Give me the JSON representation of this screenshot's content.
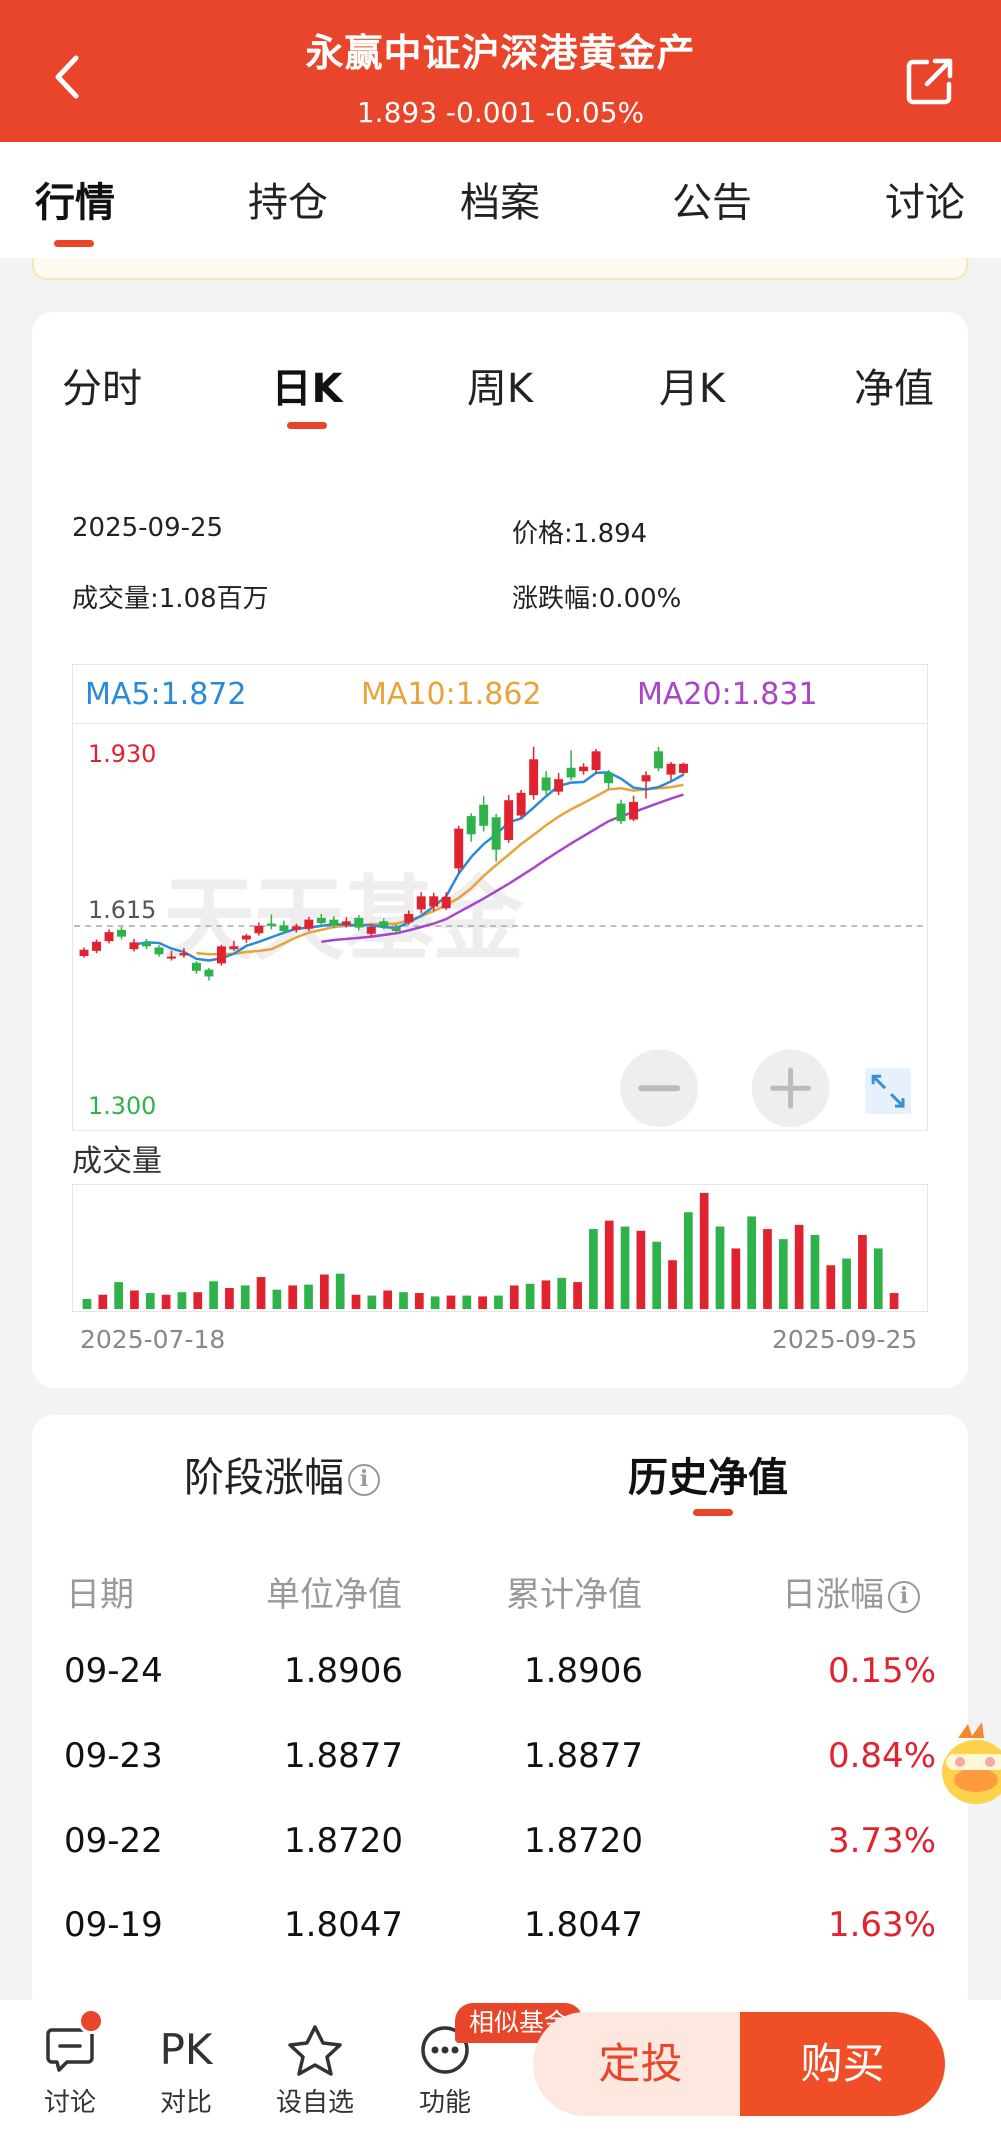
{
  "header": {
    "title": "永赢中证沪深港黄金产",
    "subtitle": "1.893 -0.001 -0.05%"
  },
  "main_tabs": [
    {
      "label": "行情",
      "active": true
    },
    {
      "label": "持仓"
    },
    {
      "label": "档案"
    },
    {
      "label": "公告"
    },
    {
      "label": "讨论"
    }
  ],
  "chart_tabs": [
    {
      "label": "分时"
    },
    {
      "label": "日K",
      "active": true
    },
    {
      "label": "周K"
    },
    {
      "label": "月K"
    },
    {
      "label": "净值"
    }
  ],
  "info": {
    "date": "2025-09-25",
    "price": "价格:1.894",
    "volume": "成交量:1.08百万",
    "change": "涨跌幅:0.00%"
  },
  "ma_legend": {
    "ma5": "MA5:1.872",
    "ma10": "MA10:1.862",
    "ma20": "MA20:1.831"
  },
  "colors": {
    "brand": "#e8452a",
    "up": "#e0232e",
    "down": "#2db34a",
    "ma5": "#2a8ad8",
    "ma10": "#e8a43a",
    "ma20": "#a845c8"
  },
  "chart_data": {
    "type": "candlestick",
    "y_ticks": [
      "1.930",
      "1.615",
      "1.300"
    ],
    "ylim": [
      1.3,
      1.93
    ],
    "watermark": "天天基金",
    "volume_label": "成交量",
    "x_start": "2025-07-18",
    "x_end": "2025-09-25",
    "candles": [
      {
        "o": 1.571,
        "c": 1.582,
        "h": 1.586,
        "l": 1.568
      },
      {
        "o": 1.58,
        "c": 1.596,
        "h": 1.6,
        "l": 1.576
      },
      {
        "o": 1.597,
        "c": 1.613,
        "h": 1.618,
        "l": 1.593
      },
      {
        "o": 1.617,
        "c": 1.605,
        "h": 1.622,
        "l": 1.6
      },
      {
        "o": 1.583,
        "c": 1.595,
        "h": 1.601,
        "l": 1.579
      },
      {
        "o": 1.595,
        "c": 1.588,
        "h": 1.601,
        "l": 1.583
      },
      {
        "o": 1.586,
        "c": 1.574,
        "h": 1.59,
        "l": 1.57
      },
      {
        "o": 1.567,
        "c": 1.57,
        "h": 1.58,
        "l": 1.563
      },
      {
        "o": 1.572,
        "c": 1.576,
        "h": 1.585,
        "l": 1.568
      },
      {
        "o": 1.559,
        "c": 1.545,
        "h": 1.562,
        "l": 1.54
      },
      {
        "o": 1.547,
        "c": 1.535,
        "h": 1.55,
        "l": 1.528
      },
      {
        "o": 1.558,
        "c": 1.588,
        "h": 1.591,
        "l": 1.554
      },
      {
        "o": 1.583,
        "c": 1.588,
        "h": 1.598,
        "l": 1.58
      },
      {
        "o": 1.6,
        "c": 1.607,
        "h": 1.61,
        "l": 1.594
      },
      {
        "o": 1.611,
        "c": 1.624,
        "h": 1.63,
        "l": 1.607
      },
      {
        "o": 1.628,
        "c": 1.624,
        "h": 1.644,
        "l": 1.618
      },
      {
        "o": 1.625,
        "c": 1.615,
        "h": 1.633,
        "l": 1.61
      },
      {
        "o": 1.617,
        "c": 1.623,
        "h": 1.628,
        "l": 1.612
      },
      {
        "o": 1.619,
        "c": 1.635,
        "h": 1.64,
        "l": 1.615
      },
      {
        "o": 1.638,
        "c": 1.629,
        "h": 1.645,
        "l": 1.625
      },
      {
        "o": 1.635,
        "c": 1.626,
        "h": 1.641,
        "l": 1.62
      },
      {
        "o": 1.626,
        "c": 1.632,
        "h": 1.639,
        "l": 1.621
      },
      {
        "o": 1.638,
        "c": 1.621,
        "h": 1.643,
        "l": 1.616
      },
      {
        "o": 1.61,
        "c": 1.622,
        "h": 1.626,
        "l": 1.605
      },
      {
        "o": 1.632,
        "c": 1.623,
        "h": 1.637,
        "l": 1.618
      },
      {
        "o": 1.621,
        "c": 1.615,
        "h": 1.627,
        "l": 1.613
      },
      {
        "o": 1.63,
        "c": 1.645,
        "h": 1.651,
        "l": 1.626
      },
      {
        "o": 1.653,
        "c": 1.676,
        "h": 1.683,
        "l": 1.646
      },
      {
        "o": 1.658,
        "c": 1.676,
        "h": 1.682,
        "l": 1.65
      },
      {
        "o": 1.655,
        "c": 1.675,
        "h": 1.683,
        "l": 1.652
      },
      {
        "o": 1.725,
        "c": 1.795,
        "h": 1.8,
        "l": 1.717
      },
      {
        "o": 1.817,
        "c": 1.785,
        "h": 1.822,
        "l": 1.772
      },
      {
        "o": 1.837,
        "c": 1.8,
        "h": 1.852,
        "l": 1.79
      },
      {
        "o": 1.815,
        "c": 1.758,
        "h": 1.821,
        "l": 1.737
      },
      {
        "o": 1.775,
        "c": 1.845,
        "h": 1.854,
        "l": 1.77
      },
      {
        "o": 1.818,
        "c": 1.858,
        "h": 1.863,
        "l": 1.813
      },
      {
        "o": 1.854,
        "c": 1.917,
        "h": 1.939,
        "l": 1.846
      },
      {
        "o": 1.885,
        "c": 1.862,
        "h": 1.896,
        "l": 1.855
      },
      {
        "o": 1.86,
        "c": 1.882,
        "h": 1.893,
        "l": 1.854
      },
      {
        "o": 1.902,
        "c": 1.885,
        "h": 1.933,
        "l": 1.88
      },
      {
        "o": 1.896,
        "c": 1.904,
        "h": 1.91,
        "l": 1.89
      },
      {
        "o": 1.898,
        "c": 1.931,
        "h": 1.935,
        "l": 1.892
      },
      {
        "o": 1.893,
        "c": 1.875,
        "h": 1.898,
        "l": 1.865
      },
      {
        "o": 1.839,
        "c": 1.808,
        "h": 1.846,
        "l": 1.803
      },
      {
        "o": 1.811,
        "c": 1.842,
        "h": 1.853,
        "l": 1.808
      },
      {
        "o": 1.878,
        "c": 1.889,
        "h": 1.896,
        "l": 1.848
      },
      {
        "o": 1.931,
        "c": 1.901,
        "h": 1.939,
        "l": 1.896
      },
      {
        "o": 1.89,
        "c": 1.909,
        "h": 1.912,
        "l": 1.88
      },
      {
        "o": 1.893,
        "c": 1.909,
        "h": 1.911,
        "l": 1.89
      }
    ],
    "volumes": [
      0.12,
      0.17,
      0.32,
      0.22,
      0.19,
      0.17,
      0.2,
      0.2,
      0.33,
      0.25,
      0.28,
      0.38,
      0.23,
      0.28,
      0.29,
      0.41,
      0.42,
      0.17,
      0.16,
      0.22,
      0.2,
      0.19,
      0.15,
      0.16,
      0.16,
      0.15,
      0.16,
      0.28,
      0.3,
      0.34,
      0.37,
      0.32,
      0.95,
      1.05,
      0.98,
      0.93,
      0.8,
      0.58,
      1.15,
      1.38,
      0.98,
      0.72,
      1.1,
      0.95,
      0.83,
      1.0,
      0.88,
      0.52,
      0.6,
      0.88,
      0.72,
      0.19
    ],
    "ma5": [
      null,
      null,
      null,
      null,
      1.591,
      1.595,
      1.594,
      1.584,
      1.578,
      1.566,
      1.563,
      1.567,
      1.575,
      1.589,
      1.596,
      1.604,
      1.612,
      1.619,
      1.621,
      1.624,
      1.627,
      1.626,
      1.625,
      1.625,
      1.622,
      1.62,
      1.63,
      1.642,
      1.658,
      1.676,
      1.716,
      1.745,
      1.768,
      1.785,
      1.806,
      1.813,
      1.832,
      1.852,
      1.87,
      1.876,
      1.877,
      1.893,
      1.894,
      1.883,
      1.867,
      1.864,
      1.868,
      1.878,
      1.89
    ],
    "ma10": [
      null,
      null,
      null,
      null,
      null,
      null,
      null,
      null,
      null,
      1.576,
      1.574,
      1.574,
      1.575,
      1.578,
      1.58,
      1.583,
      1.593,
      1.604,
      1.612,
      1.617,
      1.622,
      1.624,
      1.625,
      1.627,
      1.627,
      1.628,
      1.633,
      1.641,
      1.65,
      1.661,
      1.673,
      1.69,
      1.712,
      1.731,
      1.749,
      1.768,
      1.784,
      1.801,
      1.816,
      1.829,
      1.84,
      1.852,
      1.864,
      1.866,
      1.862,
      1.864,
      1.866,
      1.868,
      1.872
    ],
    "ma20": [
      null,
      null,
      null,
      null,
      null,
      null,
      null,
      null,
      null,
      null,
      null,
      null,
      null,
      null,
      null,
      null,
      null,
      null,
      null,
      1.596,
      1.599,
      1.601,
      1.603,
      1.605,
      1.608,
      1.611,
      1.616,
      1.622,
      1.628,
      1.636,
      1.648,
      1.66,
      1.672,
      1.685,
      1.698,
      1.712,
      1.726,
      1.741,
      1.755,
      1.769,
      1.782,
      1.795,
      1.808,
      1.817,
      1.824,
      1.832,
      1.84,
      1.848,
      1.855
    ]
  },
  "history": {
    "tab_stage": "阶段涨幅",
    "tab_history": "历史净值",
    "col_date": "日期",
    "col_unit": "单位净值",
    "col_acc": "累计净值",
    "col_change": "日涨幅",
    "rows": [
      {
        "date": "09-24",
        "unit": "1.8906",
        "acc": "1.8906",
        "change": "0.15%"
      },
      {
        "date": "09-23",
        "unit": "1.8877",
        "acc": "1.8877",
        "change": "0.84%"
      },
      {
        "date": "09-22",
        "unit": "1.8720",
        "acc": "1.8720",
        "change": "3.73%"
      },
      {
        "date": "09-19",
        "unit": "1.8047",
        "acc": "1.8047",
        "change": "1.63%"
      }
    ]
  },
  "bottom": {
    "discuss": "讨论",
    "pk_text": "PK",
    "compare": "对比",
    "watchlist": "设自选",
    "functions": "功能",
    "similar_badge": "相似基金",
    "dingtou": "定投",
    "buy": "购买"
  }
}
